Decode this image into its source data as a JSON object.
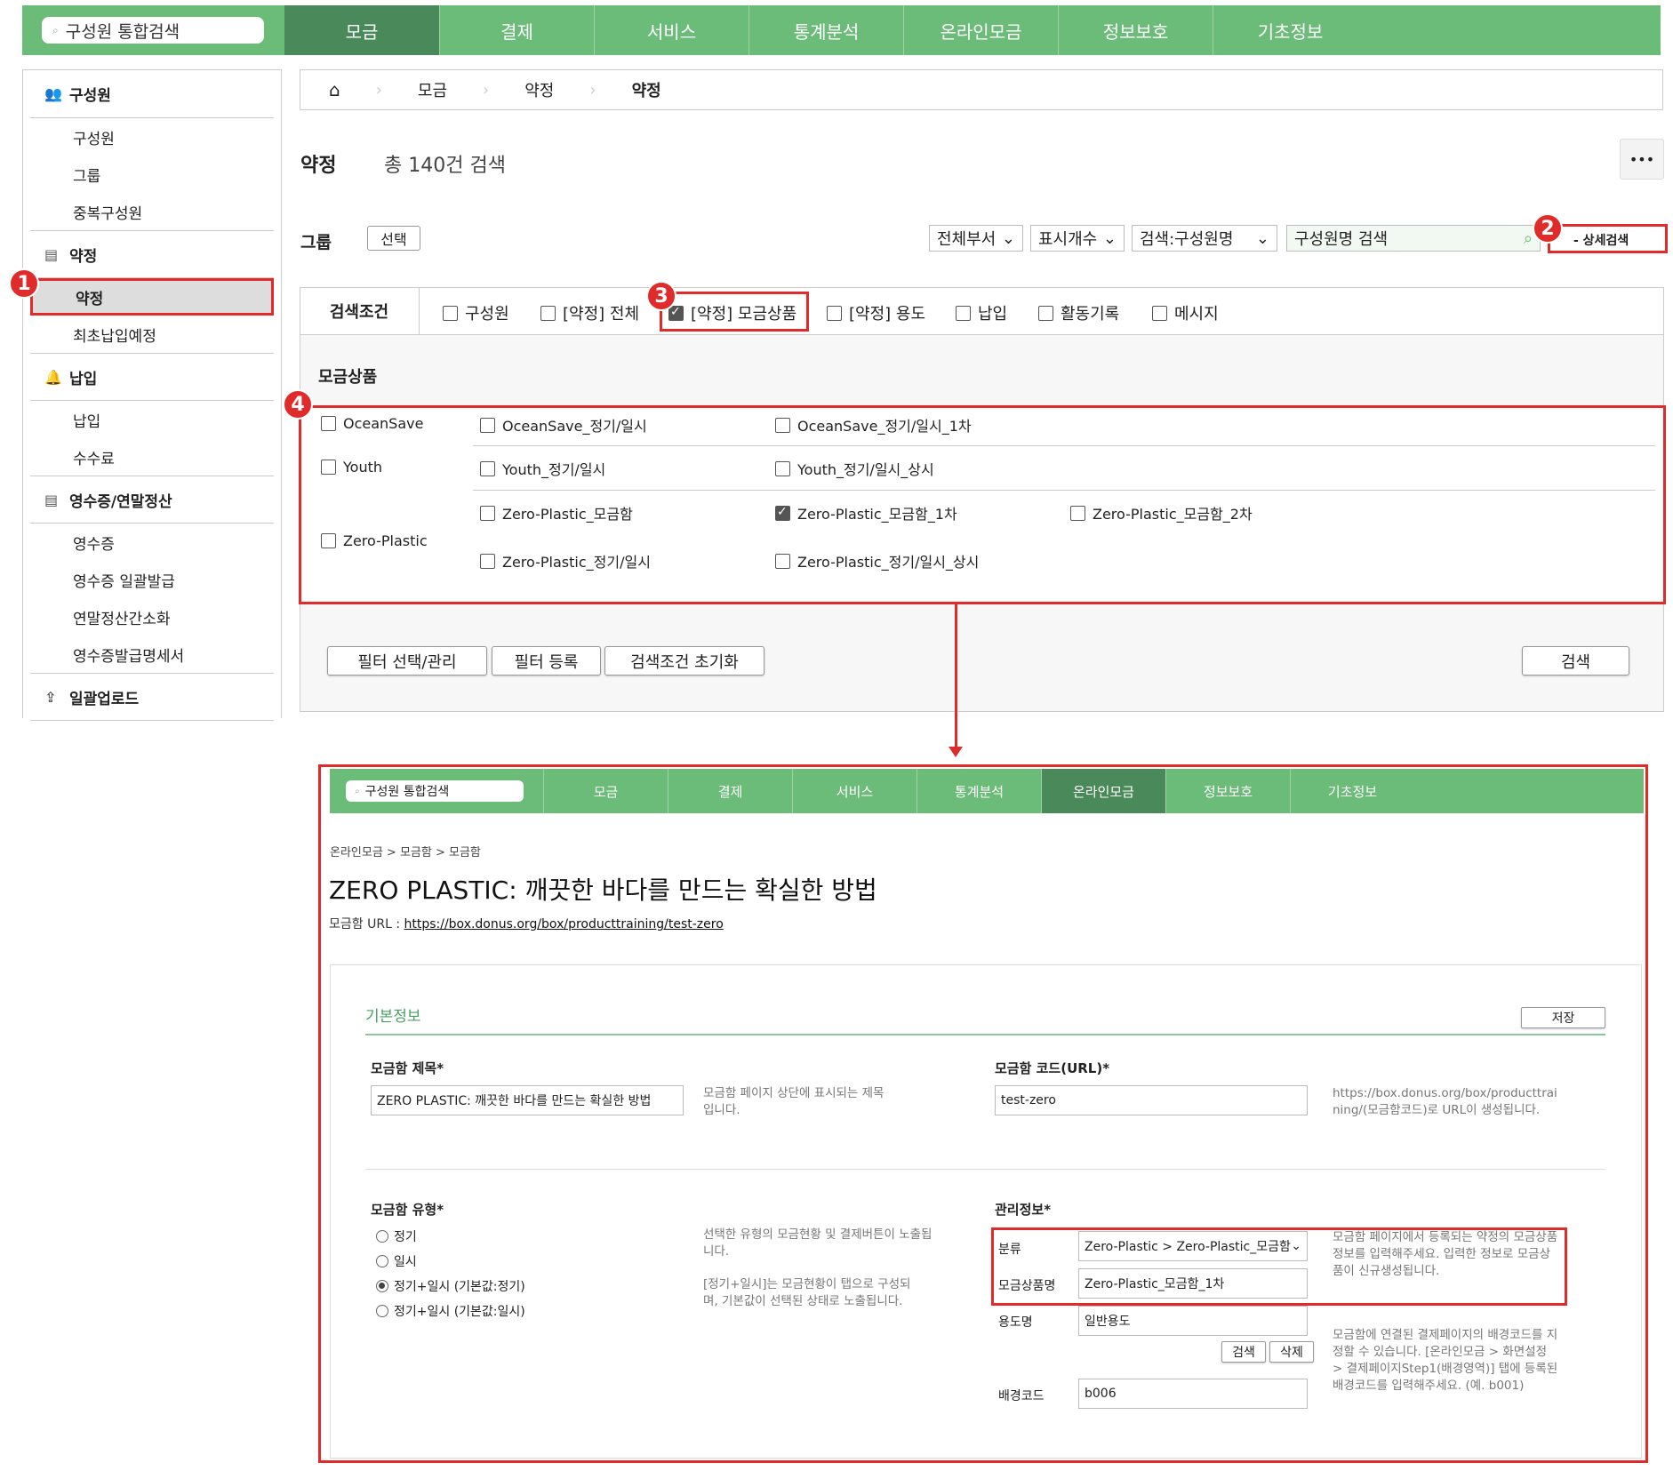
{
  "topnav": {
    "search_placeholder": "구성원 통합검색",
    "tabs": [
      "모금",
      "결제",
      "서비스",
      "통계분석",
      "온라인모금",
      "정보보호",
      "기초정보"
    ]
  },
  "sidebar": {
    "sections": [
      {
        "title": "구성원",
        "icon": "people-icon",
        "items": [
          "구성원",
          "그룹",
          "중복구성원"
        ]
      },
      {
        "title": "약정",
        "icon": "document-icon",
        "items": [
          "약정",
          "최초납입예정"
        ]
      },
      {
        "title": "납입",
        "icon": "bell-icon",
        "items": [
          "납입",
          "수수료"
        ]
      },
      {
        "title": "영수증/연말정산",
        "icon": "document-icon",
        "items": [
          "영수증",
          "영수증 일괄발급",
          "연말정산간소화",
          "영수증발급명세서"
        ]
      },
      {
        "title": "일괄업로드",
        "icon": "upload-icon",
        "items": []
      }
    ]
  },
  "breadcrumb": [
    "모금",
    "약정",
    "약정"
  ],
  "page": {
    "title": "약정",
    "count": "총 140건 검색",
    "more": "•••"
  },
  "filter": {
    "group_label": "그룹",
    "group_btn": "선택",
    "dept": "전체부서",
    "count_sel": "표시개수",
    "search_by": "검색:구성원명",
    "search_placeholder": "구성원명 검색",
    "detail_btn": "- 상세검색"
  },
  "conditions": {
    "label": "검색조건",
    "items": [
      {
        "label": "구성원",
        "checked": false
      },
      {
        "label": "[약정] 전체",
        "checked": false
      },
      {
        "label": "[약정] 모금상품",
        "checked": true
      },
      {
        "label": "[약정] 용도",
        "checked": false
      },
      {
        "label": "납입",
        "checked": false
      },
      {
        "label": "활동기록",
        "checked": false
      },
      {
        "label": "메시지",
        "checked": false
      }
    ]
  },
  "products": {
    "heading": "모금상품",
    "groups": [
      {
        "name": "OceanSave",
        "items": [
          "OceanSave_정기/일시",
          "OceanSave_정기/일시_1차"
        ]
      },
      {
        "name": "Youth",
        "items": [
          "Youth_정기/일시",
          "Youth_정기/일시_상시"
        ]
      },
      {
        "name": "Zero-Plastic",
        "items": [
          "Zero-Plastic_모금함",
          "Zero-Plastic_모금함_1차",
          "Zero-Plastic_모금함_2차",
          "Zero-Plastic_정기/일시",
          "Zero-Plastic_정기/일시_상시"
        ]
      }
    ],
    "checked": "Zero-Plastic_모금함_1차"
  },
  "actions": {
    "filter_manage": "필터 선택/관리",
    "filter_register": "필터 등록",
    "reset": "검색조건 초기화",
    "search": "검색"
  },
  "badges": [
    "1",
    "2",
    "3",
    "4"
  ],
  "inner": {
    "search_placeholder": "구성원 통합검색",
    "tabs": [
      "모금",
      "결제",
      "서비스",
      "통계분석",
      "온라인모금",
      "정보보호",
      "기초정보"
    ],
    "breadcrumb": "온라인모금 > 모금함 > 모금함",
    "title": "ZERO PLASTIC: 깨끗한 바다를 만드는 확실한 방법",
    "url_label": "모금함 URL : ",
    "url": "https://box.donus.org/box/producttraining/test-zero",
    "section": "기본정보",
    "save": "저장",
    "box_title_label": "모금함 제목*",
    "box_title_value": "ZERO PLASTIC: 깨끗한 바다를 만드는 확실한 방법",
    "box_title_help": "모금함 페이지 상단에 표시되는 제목입니다.",
    "box_code_label": "모금함 코드(URL)*",
    "box_code_value": "test-zero",
    "box_code_help": "https://box.donus.org/box/producttraining/(모금함코드)로 URL이 생성됩니다.",
    "type_label": "모금함 유형*",
    "types": [
      "정기",
      "일시",
      "정기+일시 (기본값:정기)",
      "정기+일시 (기본값:일시)"
    ],
    "type_help1": "선택한 유형의 모금현황 및 결제버튼이 노출됩니다.",
    "type_help2": "[정기+일시]는 모금현황이 탭으로 구성되며, 기본값이 선택된 상태로 노출됩니다.",
    "mgmt_label": "관리정보*",
    "category_label": "분류",
    "category_value": "Zero-Plastic > Zero-Plastic_모금함",
    "product_label": "모금상품명",
    "product_value": "Zero-Plastic_모금함_1차",
    "mgmt_help": "모금함 페이지에서 등록되는 약정의 모금상품 정보를 입력해주세요. 입력한 정보로 모금상품이 신규생성됩니다.",
    "usage_label": "용도명",
    "usage_value": "일반용도",
    "search_btn": "검색",
    "delete_btn": "삭제",
    "bg_label": "배경코드",
    "bg_value": "b006",
    "bg_help": "모금함에 연결된 결제페이지의 배경코드를 지정할 수 있습니다. [온라인모금 > 화면설정 > 결제페이지Step1(배경영역)] 탭에 등록된 배경코드를 입력해주세요. (예. b001)"
  }
}
